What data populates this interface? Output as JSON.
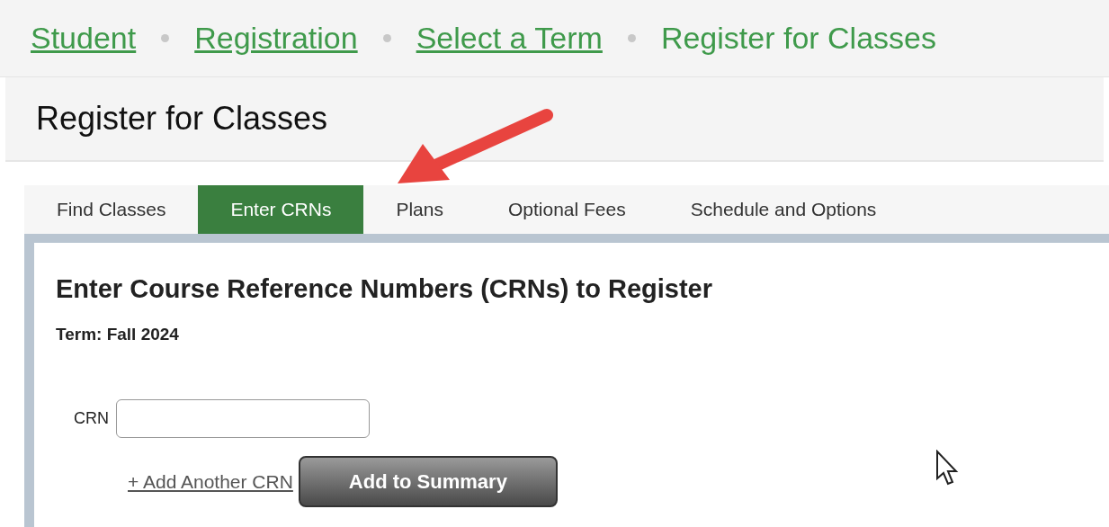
{
  "breadcrumb": [
    {
      "label": "Student",
      "link": true
    },
    {
      "label": "Registration",
      "link": true
    },
    {
      "label": "Select a Term",
      "link": true
    },
    {
      "label": "Register for Classes",
      "link": false
    }
  ],
  "page_title": "Register for Classes",
  "tabs": [
    {
      "label": "Find Classes",
      "selected": false
    },
    {
      "label": "Enter CRNs",
      "selected": true
    },
    {
      "label": "Plans",
      "selected": false
    },
    {
      "label": "Optional Fees",
      "selected": false
    },
    {
      "label": "Schedule and Options",
      "selected": false
    }
  ],
  "panel": {
    "heading": "Enter Course Reference Numbers (CRNs) to Register",
    "term": "Term: Fall 2024",
    "crn_label": "CRN",
    "add_link": "+ Add Another CRN",
    "submit": "Add to Summary"
  }
}
